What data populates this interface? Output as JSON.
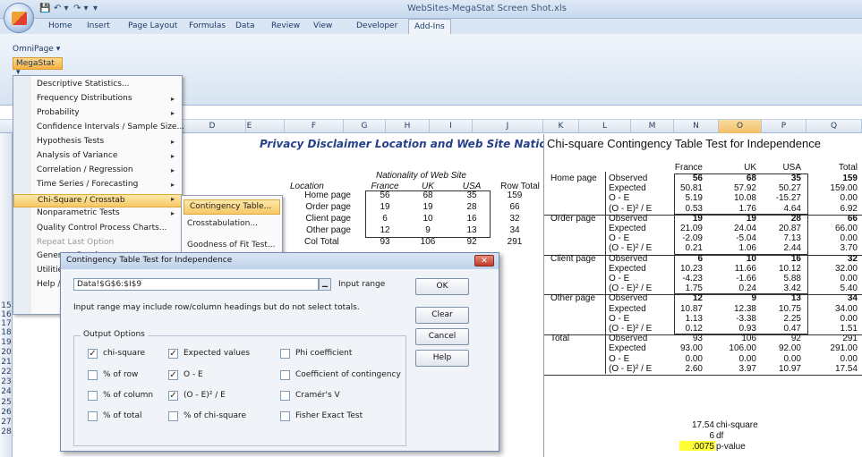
{
  "window": {
    "title": "WebSites-MegaStat Screen Shot.xls",
    "ribbon_tabs": [
      "Home",
      "Insert",
      "Page Layout",
      "Formulas",
      "Data",
      "Review",
      "View",
      "Developer",
      "Add-Ins"
    ],
    "active_tab": "Add-Ins"
  },
  "ribbon": {
    "omnipage": "OmniPage ▾",
    "megastat": "MegaStat ▾"
  },
  "columns": [
    "D",
    "E",
    "F",
    "G",
    "H",
    "I",
    "J",
    "K",
    "L",
    "M",
    "N",
    "O",
    "P",
    "Q"
  ],
  "rows": [
    "15",
    "16",
    "17",
    "18",
    "19",
    "20",
    "21",
    "22",
    "23",
    "24",
    "25",
    "26",
    "27",
    "28"
  ],
  "menu": {
    "items": [
      {
        "label": "Descriptive Statistics...",
        "arrow": false
      },
      {
        "label": "Frequency Distributions",
        "arrow": true
      },
      {
        "label": "Probability",
        "arrow": true
      },
      {
        "label": "Confidence Intervals / Sample Size...",
        "arrow": false
      },
      {
        "label": "Hypothesis Tests",
        "arrow": true
      },
      {
        "label": "Analysis of Variance",
        "arrow": true
      },
      {
        "label": "Correlation / Regression",
        "arrow": true
      },
      {
        "label": "Time Series / Forecasting",
        "arrow": true
      },
      {
        "label": "Chi-Square / Crosstab",
        "arrow": true
      },
      {
        "label": "Nonparametric Tests",
        "arrow": true
      },
      {
        "label": "Quality Control Process Charts...",
        "arrow": false
      },
      {
        "label": "Repeat Last Option",
        "arrow": false
      },
      {
        "label": "Generate Rando",
        "arrow": false
      },
      {
        "label": "Utilities",
        "arrow": false
      },
      {
        "label": "Help / Informati",
        "arrow": false
      }
    ],
    "submenu": [
      "Contingency Table...",
      "Crosstabulation...",
      "Goodness of Fit Test..."
    ]
  },
  "sheet": {
    "title": "Privacy Disclaimer Location and Web Site Nationality",
    "header_group": "Nationality of Web Site",
    "location_label": "Location",
    "col_headers": [
      "France",
      "UK",
      "USA",
      "Row Total"
    ],
    "rows": [
      {
        "label": "Home page",
        "values": [
          "56",
          "68",
          "35",
          "159"
        ]
      },
      {
        "label": "Order page",
        "values": [
          "19",
          "19",
          "28",
          "66"
        ]
      },
      {
        "label": "Client page",
        "values": [
          "6",
          "10",
          "16",
          "32"
        ]
      },
      {
        "label": "Other page",
        "values": [
          "12",
          "9",
          "13",
          "34"
        ]
      }
    ],
    "col_total": {
      "label": "Col Total",
      "values": [
        "93",
        "106",
        "92",
        "291"
      ]
    }
  },
  "output": {
    "title": "Chi-square Contingency Table Test for Independence",
    "col_headers": [
      "France",
      "UK",
      "USA",
      "Total"
    ],
    "blocks": [
      {
        "label": "Home page",
        "rows": [
          {
            "stat": "Observed",
            "values": [
              "56",
              "68",
              "35",
              "159"
            ]
          },
          {
            "stat": "Expected",
            "values": [
              "50.81",
              "57.92",
              "50.27",
              "159.00"
            ]
          },
          {
            "stat": "O - E",
            "values": [
              "5.19",
              "10.08",
              "-15.27",
              "0.00"
            ]
          },
          {
            "stat": "(O - E)² / E",
            "values": [
              "0.53",
              "1.76",
              "4.64",
              "6.92"
            ]
          }
        ]
      },
      {
        "label": "Order page",
        "rows": [
          {
            "stat": "Observed",
            "values": [
              "19",
              "19",
              "28",
              "66"
            ]
          },
          {
            "stat": "Expected",
            "values": [
              "21.09",
              "24.04",
              "20.87",
              "66.00"
            ]
          },
          {
            "stat": "O - E",
            "values": [
              "-2.09",
              "-5.04",
              "7.13",
              "0.00"
            ]
          },
          {
            "stat": "(O - E)² / E",
            "values": [
              "0.21",
              "1.06",
              "2.44",
              "3.70"
            ]
          }
        ]
      },
      {
        "label": "Client page",
        "rows": [
          {
            "stat": "Observed",
            "values": [
              "6",
              "10",
              "16",
              "32"
            ]
          },
          {
            "stat": "Expected",
            "values": [
              "10.23",
              "11.66",
              "10.12",
              "32.00"
            ]
          },
          {
            "stat": "O - E",
            "values": [
              "-4.23",
              "-1.66",
              "5.88",
              "0.00"
            ]
          },
          {
            "stat": "(O - E)² / E",
            "values": [
              "1.75",
              "0.24",
              "3.42",
              "5.40"
            ]
          }
        ]
      },
      {
        "label": "Other page",
        "rows": [
          {
            "stat": "Observed",
            "values": [
              "12",
              "9",
              "13",
              "34"
            ]
          },
          {
            "stat": "Expected",
            "values": [
              "10.87",
              "12.38",
              "10.75",
              "34.00"
            ]
          },
          {
            "stat": "O - E",
            "values": [
              "1.13",
              "-3.38",
              "2.25",
              "0.00"
            ]
          },
          {
            "stat": "(O - E)² / E",
            "values": [
              "0.12",
              "0.93",
              "0.47",
              "1.51"
            ]
          }
        ]
      },
      {
        "label": "Total",
        "rows": [
          {
            "stat": "Observed",
            "values": [
              "93",
              "106",
              "92",
              "291"
            ]
          },
          {
            "stat": "Expected",
            "values": [
              "93.00",
              "106.00",
              "92.00",
              "291.00"
            ]
          },
          {
            "stat": "O - E",
            "values": [
              "0.00",
              "0.00",
              "0.00",
              "0.00"
            ]
          },
          {
            "stat": "(O - E)² / E",
            "values": [
              "2.60",
              "3.97",
              "10.97",
              "17.54"
            ]
          }
        ]
      }
    ],
    "summary": [
      {
        "value": "17.54",
        "label": "chi-square"
      },
      {
        "value": "6",
        "label": "df"
      },
      {
        "value": ".0075",
        "label": "p-value"
      }
    ],
    "highlight_color": "#ffff33"
  },
  "dialog": {
    "title": "Contingency Table Test for Independence",
    "input_range": "Data!$G$6:$I$9",
    "input_range_label": "Input range",
    "hint": "Input range may include row/column headings but do not select totals.",
    "options_legend": "Output Options",
    "options": [
      {
        "label": "chi-square",
        "checked": true
      },
      {
        "label": "Expected values",
        "checked": true
      },
      {
        "label": "Phi coefficient",
        "checked": false
      },
      {
        "label": "% of row",
        "checked": false
      },
      {
        "label": "O - E",
        "checked": true
      },
      {
        "label": "Coefficient of contingency",
        "checked": false
      },
      {
        "label": "% of column",
        "checked": false
      },
      {
        "label": "(O - E)² / E",
        "checked": true
      },
      {
        "label": "Cramér's V",
        "checked": false
      },
      {
        "label": "% of total",
        "checked": false
      },
      {
        "label": "% of chi-square",
        "checked": false
      },
      {
        "label": "Fisher Exact Test",
        "checked": false
      }
    ],
    "buttons": [
      "OK",
      "Clear",
      "Cancel",
      "Help"
    ]
  }
}
